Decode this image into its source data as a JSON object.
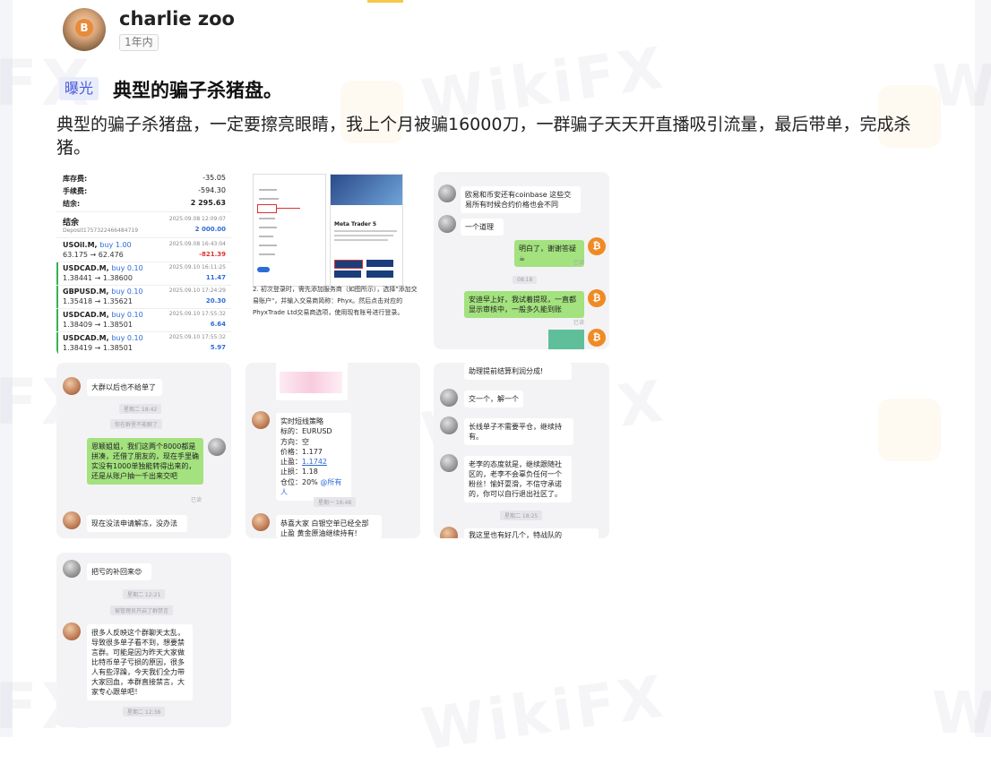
{
  "author": {
    "name": "charlie zoo",
    "time": "1年内"
  },
  "post": {
    "tag": "曝光",
    "title": "典型的骗子杀猪盘。",
    "body": "典型的骗子杀猪盘，一定要擦亮眼睛，我上个月被骗16000刀，一群骗子天天开直播吸引流量，最后带单，完成杀猪。"
  },
  "watermark": {
    "text": "WikiFX",
    "short": "FX"
  },
  "images": {
    "trading": {
      "fees": [
        {
          "label": "库存费:",
          "value": "-35.05"
        },
        {
          "label": "手续费:",
          "value": "-594.30"
        },
        {
          "label": "结余:",
          "value": "2 295.63"
        }
      ],
      "balance": {
        "label": "结余",
        "id": "Deposit1757322466484719",
        "date": "2025.09.08 12:09:07",
        "amount": "2 000.00"
      },
      "trades": [
        {
          "symbol": "USOil.M,",
          "side": "buy 1.00",
          "prices": "63.175 → 62.476",
          "date": "2025.09.08 16:43:04",
          "pl": "-821.39",
          "pl_color": "#e03131"
        },
        {
          "symbol": "USDCAD.M,",
          "side": "buy 0.10",
          "prices": "1.38441 → 1.38600",
          "date": "2025.09.10 16:11:25",
          "pl": "11.47",
          "pl_color": "#2d6cd8"
        },
        {
          "symbol": "GBPUSD.M,",
          "side": "buy 0.10",
          "prices": "1.35418 → 1.35621",
          "date": "2025.09.10 17:24:29",
          "pl": "20.30",
          "pl_color": "#2d6cd8"
        },
        {
          "symbol": "USDCAD.M,",
          "side": "buy 0.10",
          "prices": "1.38409 → 1.38501",
          "date": "2025.09.10 17:55:32",
          "pl": "6.64",
          "pl_color": "#2d6cd8"
        },
        {
          "symbol": "USDCAD.M,",
          "side": "buy 0.10",
          "prices": "1.38419 → 1.38501",
          "date": "2025.09.10 17:55:32",
          "pl": "5.97",
          "pl_color": "#2d6cd8"
        }
      ]
    },
    "guide": {
      "app_title": "Meta Trader 5",
      "caption": "2. 初次登录时，需先添加服务商（如图所示），选择\"添加交易账户\"，并输入交易商简称：Phyx。然后点击对应的PhyxTrade Ltd交易商选项，使用现有账号进行登录。"
    },
    "chat1": {
      "msg1": "欧易和币安还有coinbase 这些交易所有时候合约价格也会不同",
      "msg2": "一个道理",
      "msg3": "明白了，谢谢答疑☕",
      "read1": "已读",
      "time1": "08:18",
      "msg4": "安迪早上好，我试着提现，一直都显示审核中，一般多久能到账",
      "read2": "已读"
    },
    "chat2": {
      "msg1": "大群以后也不给单了",
      "time1": "星期二 18:42",
      "sys1": "你在群里不能聊了",
      "msg2": "恩颖姐姐，我们这两个8000都是拼凑，还借了朋友的，现在手里确实没有1000单独能转得出来的，还是从账户抽一千出来交吧",
      "read": "已读",
      "msg3": "现在没法申请解冻，没办法"
    },
    "chat3": {
      "strategy_title": "实时短线策略",
      "symbol_line": "标的：EURUSD",
      "direction_line": "方向：空",
      "price_line": "价格：1.177",
      "tp_label": "止盈：",
      "tp_value": "1.1742",
      "sl_line": "止损：1.18",
      "pos_label": "仓位：20% ",
      "pos_mention": "@所有人",
      "time1": "星期一 16:48",
      "msg2_line1": "恭喜大家  白银空单已经全部",
      "msg2_line2": "止盈       黄金原油继续持有!"
    },
    "chat4": {
      "top": "助理提前结算利润分成!",
      "msg1": "交一个，解一个",
      "msg2": "长线单子不需要平仓，继续持有。",
      "msg3": "老李的态度就是，继续跟随社区的，老李不会辜负任何一个粉丝！愉奸耍滑，不信守承诺的，你可以自行退出社区了。",
      "time1": "星期二 18:25",
      "msg4": "我这里也有好几个，特战队的"
    },
    "chat5": {
      "msg1": "把亏的补回来😍",
      "time1": "星期二 12:21",
      "sys1": "被管理员开启了群禁言",
      "msg2": "很多人反映这个群聊天太乱，导致很多单子看不到，想要禁言群。可能是因为昨天大家做比特币单子亏损的原因，很多人有些浮躁，今天我们全力带大家回血，本群直接禁言，大家专心跟单吧！",
      "time2": "星期二 12:38"
    }
  }
}
